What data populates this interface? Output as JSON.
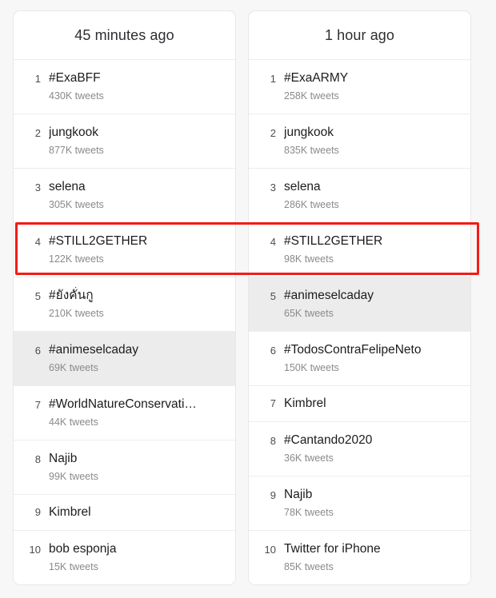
{
  "annotation": {
    "name": "red-highlight-rectangle",
    "color": "#f51a17",
    "target_rank": "4",
    "target_trend": "#STILL2GETHER"
  },
  "panels": [
    {
      "id": "panel-45-minutes-ago",
      "header": "45 minutes ago",
      "trends": [
        {
          "rank": "1",
          "name": "#ExaBFF",
          "count": "430K tweets",
          "highlight": false
        },
        {
          "rank": "2",
          "name": "jungkook",
          "count": "877K tweets",
          "highlight": false
        },
        {
          "rank": "3",
          "name": "selena",
          "count": "305K tweets",
          "highlight": false
        },
        {
          "rank": "4",
          "name": "#STILL2GETHER",
          "count": "122K tweets",
          "highlight": false
        },
        {
          "rank": "5",
          "name": "#ยังคั่นกู",
          "count": "210K tweets",
          "highlight": false
        },
        {
          "rank": "6",
          "name": "#animeselcaday",
          "count": "69K tweets",
          "highlight": true
        },
        {
          "rank": "7",
          "name": "#WorldNatureConservati…",
          "count": "44K tweets",
          "highlight": false
        },
        {
          "rank": "8",
          "name": "Najib",
          "count": "99K tweets",
          "highlight": false
        },
        {
          "rank": "9",
          "name": "Kimbrel",
          "count": "",
          "highlight": false
        },
        {
          "rank": "10",
          "name": "bob esponja",
          "count": "15K tweets",
          "highlight": false
        }
      ]
    },
    {
      "id": "panel-1-hour-ago",
      "header": "1 hour ago",
      "trends": [
        {
          "rank": "1",
          "name": "#ExaARMY",
          "count": "258K tweets",
          "highlight": false
        },
        {
          "rank": "2",
          "name": "jungkook",
          "count": "835K tweets",
          "highlight": false
        },
        {
          "rank": "3",
          "name": "selena",
          "count": "286K tweets",
          "highlight": false
        },
        {
          "rank": "4",
          "name": "#STILL2GETHER",
          "count": "98K tweets",
          "highlight": false
        },
        {
          "rank": "5",
          "name": "#animeselcaday",
          "count": "65K tweets",
          "highlight": true
        },
        {
          "rank": "6",
          "name": "#TodosContraFelipeNeto",
          "count": "150K tweets",
          "highlight": false
        },
        {
          "rank": "7",
          "name": "Kimbrel",
          "count": "",
          "highlight": false
        },
        {
          "rank": "8",
          "name": "#Cantando2020",
          "count": "36K tweets",
          "highlight": false
        },
        {
          "rank": "9",
          "name": "Najib",
          "count": "78K tweets",
          "highlight": false
        },
        {
          "rank": "10",
          "name": "Twitter for iPhone",
          "count": "85K tweets",
          "highlight": false
        }
      ]
    }
  ]
}
